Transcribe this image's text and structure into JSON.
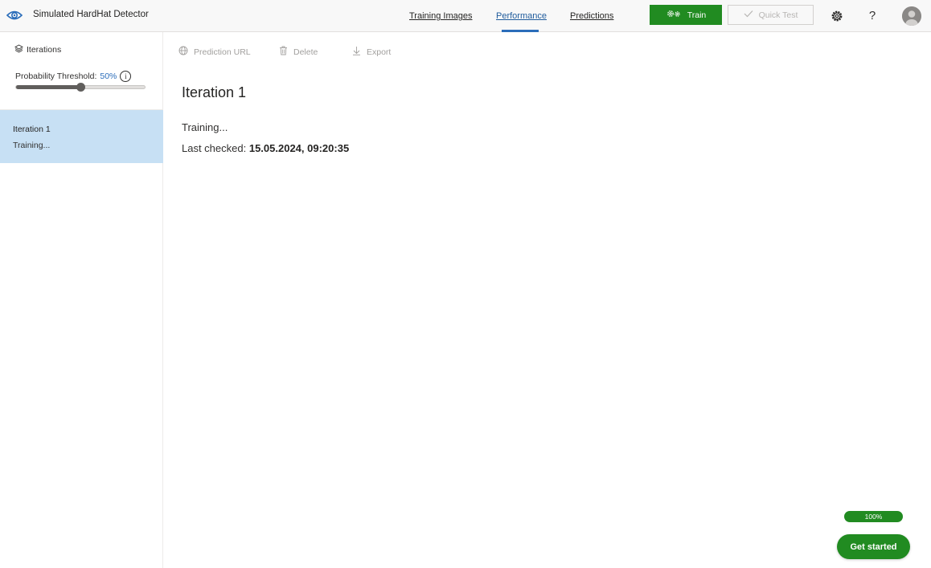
{
  "app": {
    "title": "Simulated HardHat Detector",
    "logo_icon": "eye-icon"
  },
  "nav": {
    "tabs": [
      {
        "label": "Training Images",
        "active": false
      },
      {
        "label": "Performance",
        "active": true
      },
      {
        "label": "Predictions",
        "active": false
      }
    ]
  },
  "header_actions": {
    "train_label": "Train",
    "train_icon": "gears-icon",
    "quick_test_label": "Quick Test",
    "quick_test_icon": "check-icon",
    "settings_icon": "gear-icon",
    "help_label": "?",
    "profile_icon": "avatar-icon"
  },
  "sidebar": {
    "iterations_label": "Iterations",
    "threshold_label": "Probability Threshold:",
    "threshold_value": "50%",
    "threshold_fraction": 0.5,
    "info_label": "i",
    "iterations": [
      {
        "name": "Iteration 1",
        "status": "Training...",
        "selected": true
      }
    ]
  },
  "toolbar": {
    "prediction_url": "Prediction URL",
    "delete": "Delete",
    "export": "Export"
  },
  "main": {
    "title": "Iteration 1",
    "status": "Training...",
    "last_checked_label": "Last checked:",
    "last_checked_value": "15.05.2024, 09:20:35"
  },
  "footer": {
    "progress": "100%",
    "get_started": "Get started"
  },
  "colors": {
    "accent": "#2b6dba",
    "primary_green": "#218b21",
    "selected_item": "#c7e0f4"
  }
}
